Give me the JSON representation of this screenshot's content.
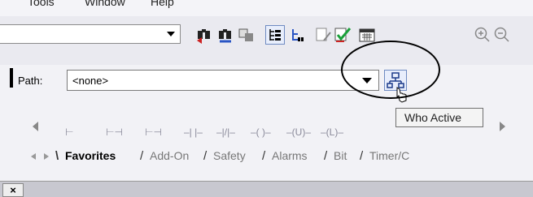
{
  "menubar": {
    "items": [
      "Tools",
      "Window",
      "Help"
    ]
  },
  "toolbar": {
    "icons": [
      "find-icon",
      "find-next-icon",
      "replace-icon",
      "verify-icon",
      "tree-icon",
      "network-icon",
      "check-icon",
      "calendar-icon",
      "zoom-in-icon",
      "zoom-out-icon"
    ]
  },
  "path": {
    "label": "Path:",
    "value": "<none>"
  },
  "who_active": {
    "tooltip": "Who Active"
  },
  "instructions": [
    "⊢",
    "⊢⊣",
    "⊢⊣",
    "–| |–",
    "–|/|–",
    "–( )–",
    "–(U)–",
    "–(L)–"
  ],
  "tabs": [
    {
      "label": "Favorites",
      "active": true
    },
    {
      "label": "Add-On",
      "active": false
    },
    {
      "label": "Safety",
      "active": false
    },
    {
      "label": "Alarms",
      "active": false
    },
    {
      "label": "Bit",
      "active": false
    },
    {
      "label": "Timer/C",
      "active": false
    }
  ],
  "bottom": {
    "close_label": "×"
  }
}
